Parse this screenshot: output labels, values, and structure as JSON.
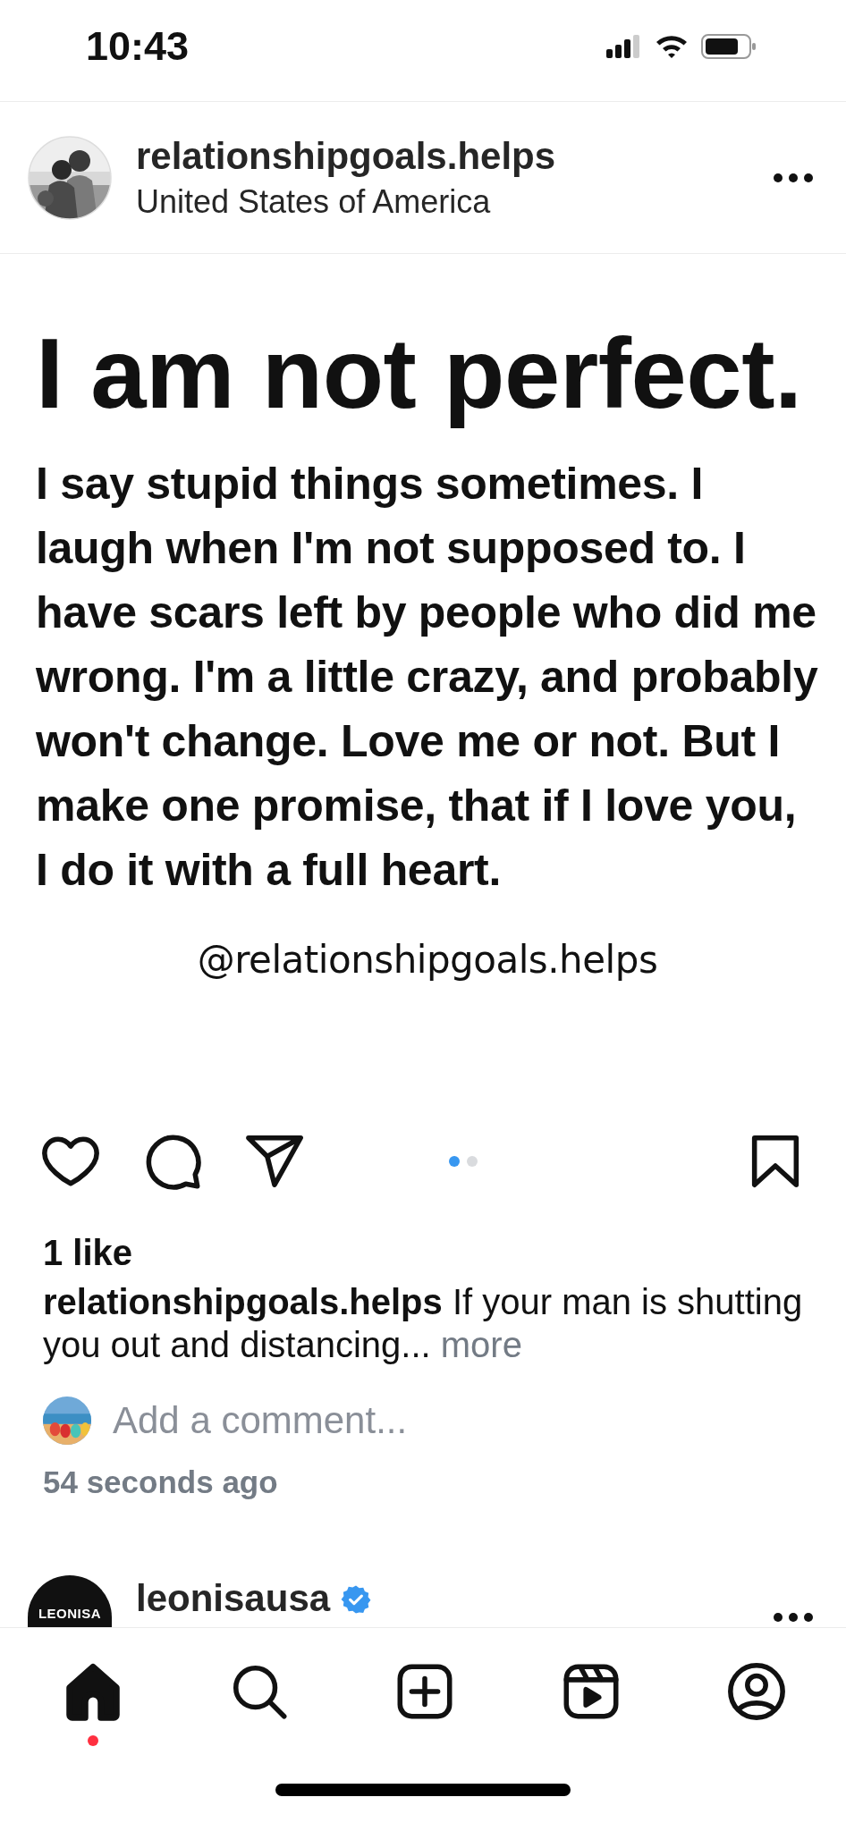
{
  "status_bar": {
    "time": "10:43"
  },
  "post": {
    "username": "relationshipgoals.helps",
    "location": "United States of America",
    "image": {
      "headline": "I am not perfect.",
      "body": "I say stupid things sometimes. I laugh when I'm not supposed to. I have scars left by people who did me wrong. I'm a little crazy, and probably won't change. Love me or not. But I make one promise, that if I love you, I do it with a full heart.",
      "handle": "@relationshipgoals.helps"
    },
    "liked": false,
    "saved": false,
    "carousel": [
      {
        "selected": true
      },
      {
        "selected": false
      }
    ],
    "likes": "1 like",
    "caption": {
      "username": "relationshipgoals.helps",
      "text": "If your man is shutting you out and distancing...",
      "more": "more"
    },
    "comment_field": {
      "placeholder": "Add a comment..."
    },
    "time": "54 seconds ago"
  },
  "next_post": {
    "avatar_text": "LEONISA",
    "username": "leonisausa",
    "verified": true
  },
  "nav": [
    {
      "kind": "home",
      "selected": true,
      "notification": true
    },
    {
      "kind": "search",
      "selected": false,
      "notification": false
    },
    {
      "kind": "create",
      "selected": false,
      "notification": false
    },
    {
      "kind": "reels",
      "selected": false,
      "notification": false
    },
    {
      "kind": "profile",
      "selected": false,
      "notification": false
    }
  ]
}
